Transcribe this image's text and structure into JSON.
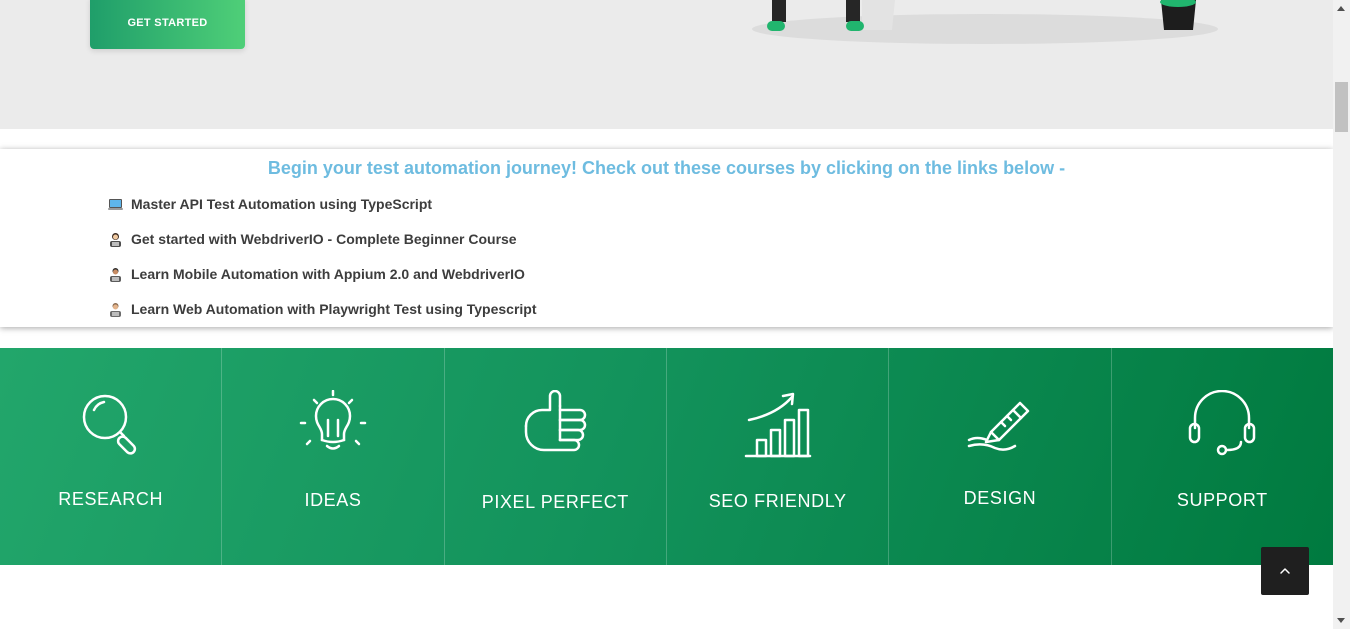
{
  "hero": {
    "cta_label": "GET STARTED"
  },
  "courses": {
    "heading": "Begin your test automation journey! Check out these courses by clicking on the links below -",
    "items": [
      {
        "label": "Master API Test Automation using TypeScript",
        "icon": "laptop-icon"
      },
      {
        "label": "Get started with WebdriverIO - Complete Beginner Course",
        "icon": "woman-technologist-icon"
      },
      {
        "label": "Learn Mobile Automation with Appium 2.0 and WebdriverIO",
        "icon": "man-technologist-icon"
      },
      {
        "label": "Learn Web Automation with Playwright Test using Typescript",
        "icon": "technologist-icon"
      }
    ]
  },
  "features": [
    {
      "label": "RESEARCH",
      "icon": "magnifier-icon"
    },
    {
      "label": "IDEAS",
      "icon": "lightbulb-icon"
    },
    {
      "label": "PIXEL PERFECT",
      "icon": "thumbs-up-icon"
    },
    {
      "label": "SEO FRIENDLY",
      "icon": "growth-chart-icon"
    },
    {
      "label": "DESIGN",
      "icon": "pen-icon"
    },
    {
      "label": "SUPPORT",
      "icon": "headset-icon"
    }
  ],
  "colors": {
    "accent": "#22a66b",
    "heading": "#6ebce0",
    "dark": "#007a3f"
  }
}
